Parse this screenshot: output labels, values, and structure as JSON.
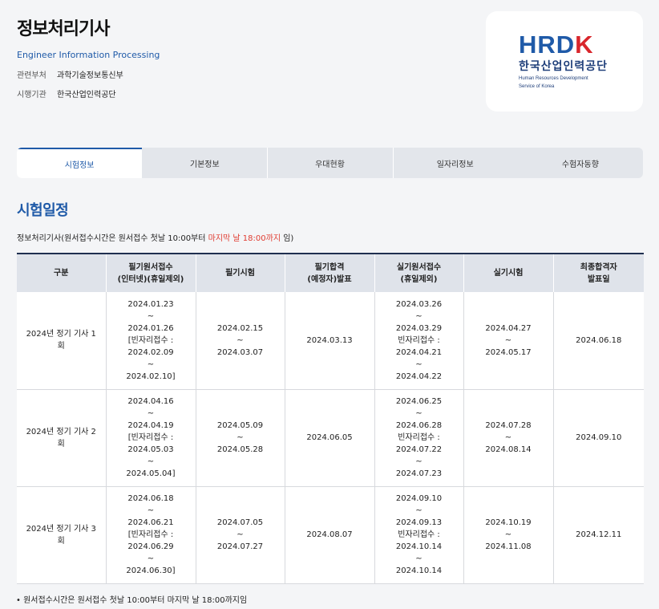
{
  "header": {
    "title": "정보처리기사",
    "subtitle": "Engineer Information Processing",
    "info": [
      {
        "key": "관련부처",
        "value": "과학기술정보통신부"
      },
      {
        "key": "시행기관",
        "value": "한국산업인력공단"
      }
    ]
  },
  "logo": {
    "main": "HRDK",
    "korean": "한국산업인력공단",
    "english_line1": "Human Resources Development",
    "english_line2": "Service of Korea"
  },
  "tabs": [
    {
      "label": "시험정보",
      "active": true
    },
    {
      "label": "기본정보",
      "active": false
    },
    {
      "label": "우대현황",
      "active": false
    },
    {
      "label": "일자리정보",
      "active": false
    },
    {
      "label": "수험자동향",
      "active": false
    }
  ],
  "section": {
    "title": "시험일정",
    "note_prefix": "정보처리기사(원서접수시간은 원서접수 첫날 10:00부터 ",
    "note_highlight": "마지막 날 18:00까지",
    "note_suffix": " 임)"
  },
  "table": {
    "headers": [
      [
        "구분"
      ],
      [
        "필기원서접수",
        "(인터넷)(휴일제외)"
      ],
      [
        "필기시험"
      ],
      [
        "필기합격",
        "(예정자)발표"
      ],
      [
        "실기원서접수",
        "(휴일제외)"
      ],
      [
        "실기시험"
      ],
      [
        "최종합격자",
        "발표일"
      ]
    ],
    "rows": [
      [
        [
          "2024년 정기 기사 1",
          "회"
        ],
        [
          "2024.01.23",
          "~",
          "2024.01.26",
          "[빈자리접수 :",
          "2024.02.09",
          "~",
          "2024.02.10]"
        ],
        [
          "2024.02.15",
          "~",
          "2024.03.07"
        ],
        [
          "2024.03.13"
        ],
        [
          "2024.03.26",
          "~",
          "2024.03.29",
          "빈자리접수 :",
          "2024.04.21",
          "~",
          "2024.04.22"
        ],
        [
          "2024.04.27",
          "~",
          "2024.05.17"
        ],
        [
          "2024.06.18"
        ]
      ],
      [
        [
          "2024년 정기 기사 2",
          "회"
        ],
        [
          "2024.04.16",
          "~",
          "2024.04.19",
          "[빈자리접수 :",
          "2024.05.03",
          "~",
          "2024.05.04]"
        ],
        [
          "2024.05.09",
          "~",
          "2024.05.28"
        ],
        [
          "2024.06.05"
        ],
        [
          "2024.06.25",
          "~",
          "2024.06.28",
          "빈자리접수 :",
          "2024.07.22",
          "~",
          "2024.07.23"
        ],
        [
          "2024.07.28",
          "~",
          "2024.08.14"
        ],
        [
          "2024.09.10"
        ]
      ],
      [
        [
          "2024년 정기 기사 3",
          "회"
        ],
        [
          "2024.06.18",
          "~",
          "2024.06.21",
          "[빈자리접수 :",
          "2024.06.29",
          "~",
          "2024.06.30]"
        ],
        [
          "2024.07.05",
          "~",
          "2024.07.27"
        ],
        [
          "2024.08.07"
        ],
        [
          "2024.09.10",
          "~",
          "2024.09.13",
          "빈자리접수 :",
          "2024.10.14",
          "~",
          "2024.10.14"
        ],
        [
          "2024.10.19",
          "~",
          "2024.11.08"
        ],
        [
          "2024.12.11"
        ]
      ]
    ]
  },
  "footnote": "• 원서접수시간은 원서접수 첫날 10:00부터 마지막 날 18:00까지임",
  "colors": {
    "accent": "#1f5aa8",
    "highlight": "#e03c31",
    "brand_red": "#d9262c"
  }
}
